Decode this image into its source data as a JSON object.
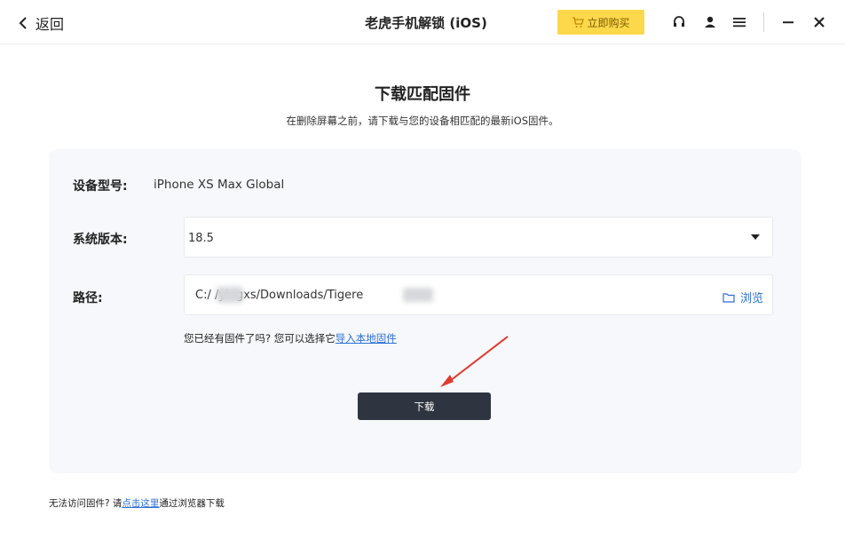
{
  "titlebar": {
    "back_label": "返回",
    "app_title": "老虎手机解锁 (iOS)",
    "buy_label": "立即购买",
    "icons": [
      "back-chevron-icon",
      "cart-icon",
      "headset-icon",
      "user-icon",
      "menu-icon",
      "minimize-icon",
      "close-icon"
    ],
    "buy_color": "#fcd84a"
  },
  "heading": {
    "title": "下载匹配固件",
    "subtitle": "在删除屏幕之前，请下载与您的设备相匹配的最新iOS固件。"
  },
  "form": {
    "model_label": "设备型号:",
    "model_value": "iPhone XS Max Global",
    "version_label": "系统版本:",
    "version_value": "18.5",
    "path_label": "路径:",
    "path_value": "C:/      /yingxs/Downloads/Tigere",
    "browse_label": "浏览",
    "hint_prefix": "您已经有固件了吗? 您可以选择它",
    "hint_link": "导入本地固件",
    "download_label": "下载",
    "accent_color": "#2c6fd6",
    "annotation_color": "#e03a2f"
  },
  "footer": {
    "prefix": "无法访问固件? 请",
    "link": "点击这里",
    "suffix": "通过浏览器下载"
  }
}
